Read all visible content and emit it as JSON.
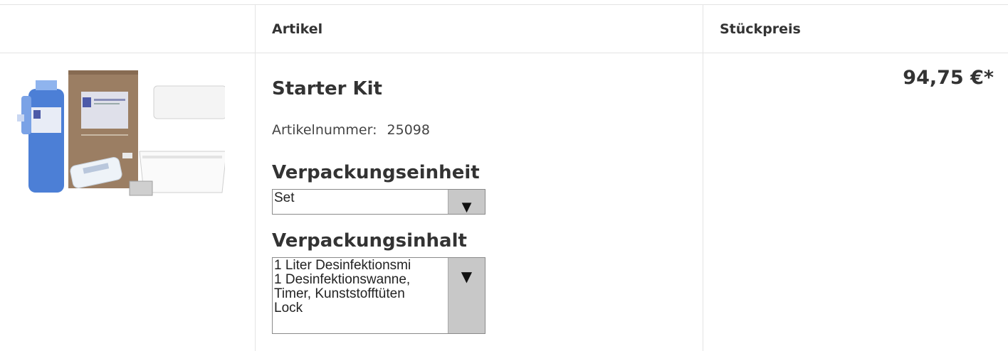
{
  "table": {
    "headers": {
      "article": "Artikel",
      "unit_price": "Stückpreis"
    }
  },
  "product": {
    "image_icon": "product-kit-image",
    "name": "Starter Kit",
    "sku_label": "Artikelnummer:",
    "sku_value": "25098",
    "packaging_unit": {
      "label": "Verpackungseinheit",
      "selected": "Set"
    },
    "packaging_content": {
      "label": "Verpackungsinhalt",
      "lines": [
        "1 Liter Desinfektionsmi",
        "1 Desinfektionswanne,",
        "Timer, Kunststofftüten",
        "Lock"
      ]
    },
    "price": "94,75 €*"
  },
  "colors": {
    "border": "#e4e4e4",
    "select_button": "#c8c8c8",
    "text": "#333333"
  }
}
